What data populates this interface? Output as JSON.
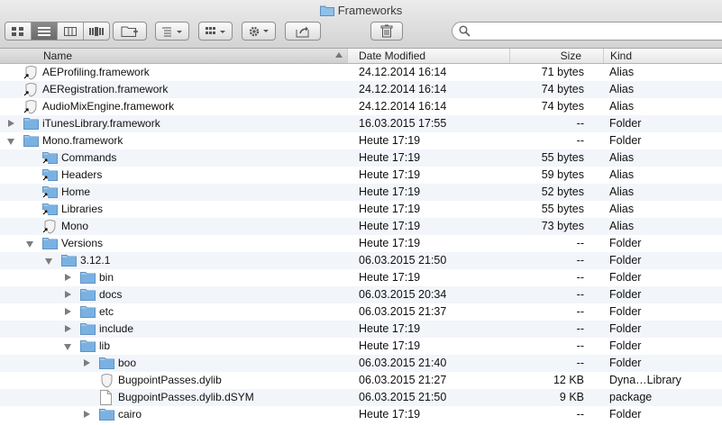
{
  "window": {
    "title": "Frameworks"
  },
  "toolbar": {
    "view_modes": [
      "icon-view",
      "list-view",
      "column-view",
      "cover-flow-view"
    ],
    "active_view": "list-view"
  },
  "search": {
    "value": "",
    "placeholder": ""
  },
  "columns": {
    "name": "Name",
    "date": "Date Modified",
    "size": "Size",
    "kind": "Kind"
  },
  "rows": [
    {
      "name": "AEProfiling.framework",
      "date": "24.12.2014 16:14",
      "size": "71 bytes",
      "kind": "Alias",
      "indent": 0,
      "icon": "alias-generic",
      "disclosure": "none"
    },
    {
      "name": "AERegistration.framework",
      "date": "24.12.2014 16:14",
      "size": "74 bytes",
      "kind": "Alias",
      "indent": 0,
      "icon": "alias-generic",
      "disclosure": "none"
    },
    {
      "name": "AudioMixEngine.framework",
      "date": "24.12.2014 16:14",
      "size": "74 bytes",
      "kind": "Alias",
      "indent": 0,
      "icon": "alias-generic",
      "disclosure": "none"
    },
    {
      "name": "iTunesLibrary.framework",
      "date": "16.03.2015 17:55",
      "size": "--",
      "kind": "Folder",
      "indent": 0,
      "icon": "folder",
      "disclosure": "closed"
    },
    {
      "name": "Mono.framework",
      "date": "Heute 17:19",
      "size": "--",
      "kind": "Folder",
      "indent": 0,
      "icon": "folder",
      "disclosure": "open"
    },
    {
      "name": "Commands",
      "date": "Heute 17:19",
      "size": "55 bytes",
      "kind": "Alias",
      "indent": 1,
      "icon": "alias-folder",
      "disclosure": "none"
    },
    {
      "name": "Headers",
      "date": "Heute 17:19",
      "size": "59 bytes",
      "kind": "Alias",
      "indent": 1,
      "icon": "alias-folder",
      "disclosure": "none"
    },
    {
      "name": "Home",
      "date": "Heute 17:19",
      "size": "52 bytes",
      "kind": "Alias",
      "indent": 1,
      "icon": "alias-folder",
      "disclosure": "none"
    },
    {
      "name": "Libraries",
      "date": "Heute 17:19",
      "size": "55 bytes",
      "kind": "Alias",
      "indent": 1,
      "icon": "alias-folder",
      "disclosure": "none"
    },
    {
      "name": "Mono",
      "date": "Heute 17:19",
      "size": "73 bytes",
      "kind": "Alias",
      "indent": 1,
      "icon": "alias-generic",
      "disclosure": "none"
    },
    {
      "name": "Versions",
      "date": "Heute 17:19",
      "size": "--",
      "kind": "Folder",
      "indent": 1,
      "icon": "folder",
      "disclosure": "open"
    },
    {
      "name": "3.12.1",
      "date": "06.03.2015 21:50",
      "size": "--",
      "kind": "Folder",
      "indent": 2,
      "icon": "folder",
      "disclosure": "open"
    },
    {
      "name": "bin",
      "date": "Heute 17:19",
      "size": "--",
      "kind": "Folder",
      "indent": 3,
      "icon": "folder",
      "disclosure": "closed"
    },
    {
      "name": "docs",
      "date": "06.03.2015 20:34",
      "size": "--",
      "kind": "Folder",
      "indent": 3,
      "icon": "folder",
      "disclosure": "closed"
    },
    {
      "name": "etc",
      "date": "06.03.2015 21:37",
      "size": "--",
      "kind": "Folder",
      "indent": 3,
      "icon": "folder",
      "disclosure": "closed"
    },
    {
      "name": "include",
      "date": "Heute 17:19",
      "size": "--",
      "kind": "Folder",
      "indent": 3,
      "icon": "folder",
      "disclosure": "closed"
    },
    {
      "name": "lib",
      "date": "Heute 17:19",
      "size": "--",
      "kind": "Folder",
      "indent": 3,
      "icon": "folder",
      "disclosure": "open"
    },
    {
      "name": "boo",
      "date": "06.03.2015 21:40",
      "size": "--",
      "kind": "Folder",
      "indent": 4,
      "icon": "folder",
      "disclosure": "closed"
    },
    {
      "name": "BugpointPasses.dylib",
      "date": "06.03.2015 21:27",
      "size": "12 KB",
      "kind": "Dyna…Library",
      "indent": 4,
      "icon": "library",
      "disclosure": "none"
    },
    {
      "name": "BugpointPasses.dylib.dSYM",
      "date": "06.03.2015 21:50",
      "size": "9 KB",
      "kind": "package",
      "indent": 4,
      "icon": "document",
      "disclosure": "none"
    },
    {
      "name": "cairo",
      "date": "Heute 17:19",
      "size": "--",
      "kind": "Folder",
      "indent": 4,
      "icon": "folder",
      "disclosure": "closed"
    }
  ]
}
